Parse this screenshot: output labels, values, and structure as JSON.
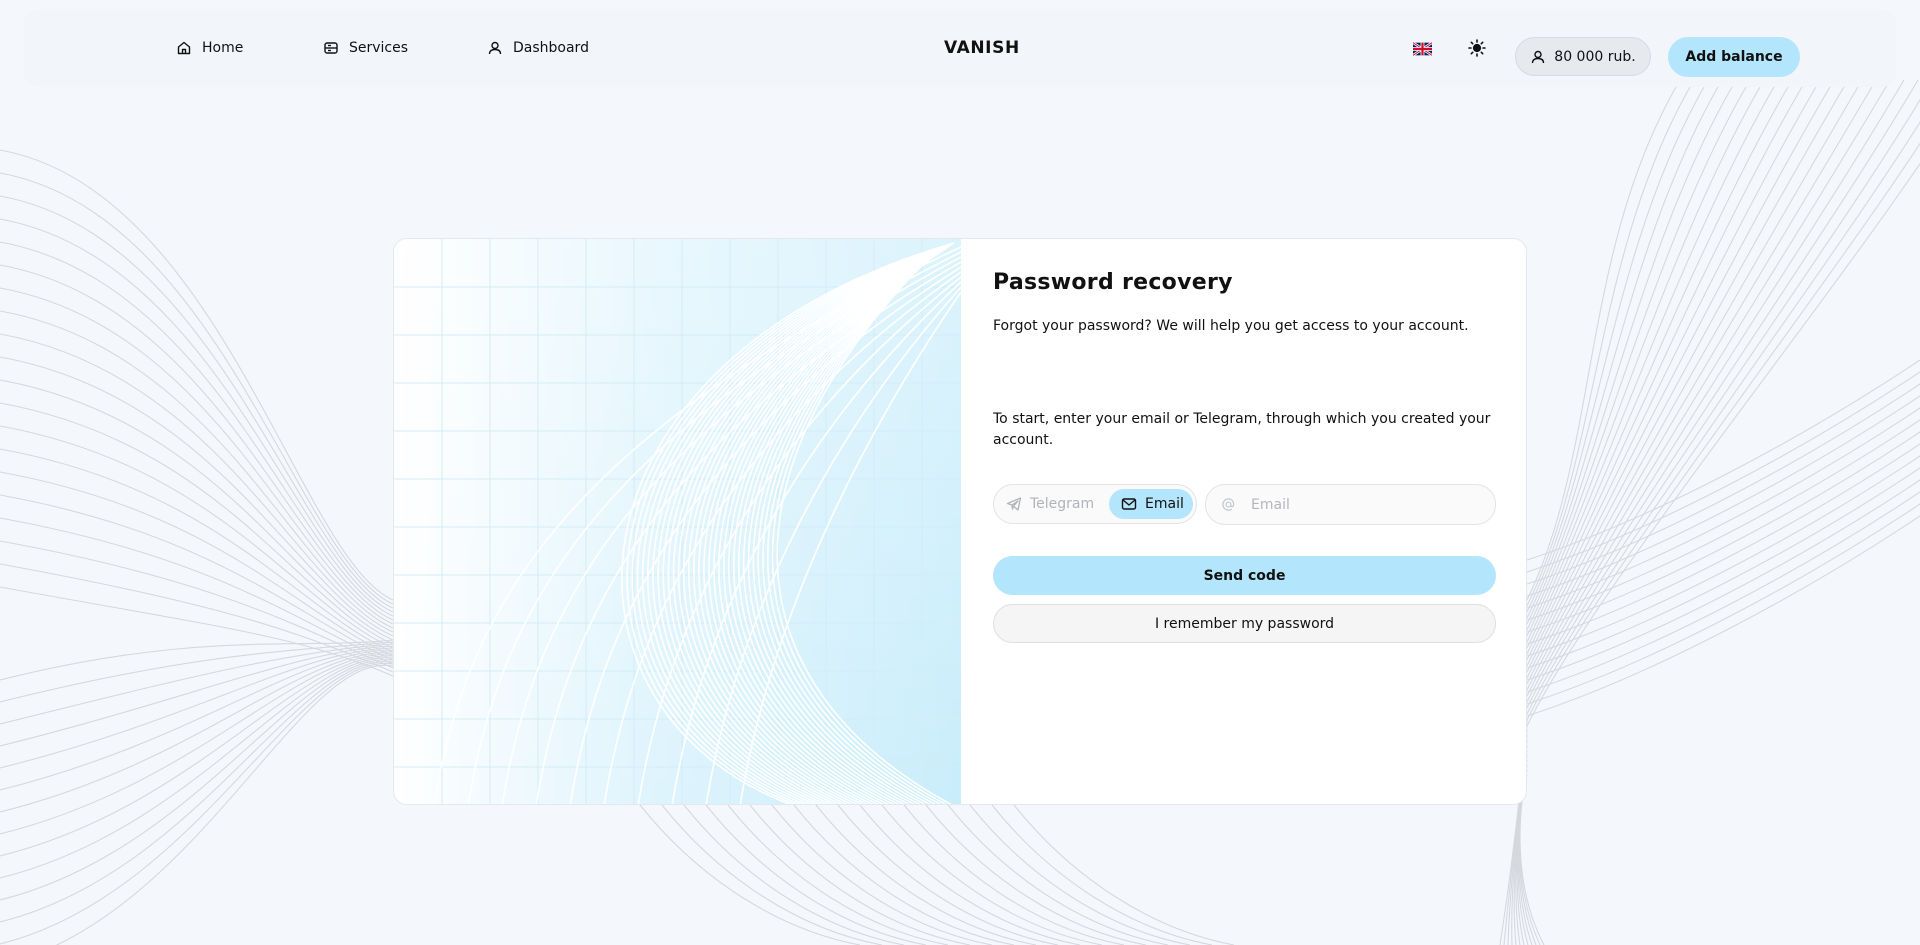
{
  "header": {
    "nav": [
      {
        "label": "Home",
        "icon": "home-icon"
      },
      {
        "label": "Services",
        "icon": "services-icon"
      },
      {
        "label": "Dashboard",
        "icon": "user-icon"
      }
    ],
    "brand": "VANISH",
    "language_flag": "uk-flag-icon",
    "theme_icon": "sun-icon",
    "balance": "80 000 rub.",
    "add_balance_label": "Add balance"
  },
  "recovery": {
    "title": "Password recovery",
    "subtitle": "Forgot your password? We will help you get access to your account.",
    "instruction": "To start, enter your email or Telegram, through which you created your account.",
    "method_options": [
      {
        "label": "Telegram",
        "icon": "telegram-icon",
        "selected": false
      },
      {
        "label": "Email",
        "icon": "mail-icon",
        "selected": true
      }
    ],
    "email_field": {
      "value": "",
      "placeholder": "Email",
      "icon": "at-icon"
    },
    "send_code_label": "Send code",
    "remember_label": "I remember my password"
  },
  "colors": {
    "accent": "#b3e5fc",
    "background": "#f4f8fd",
    "line_gray": "#d6d9de"
  }
}
